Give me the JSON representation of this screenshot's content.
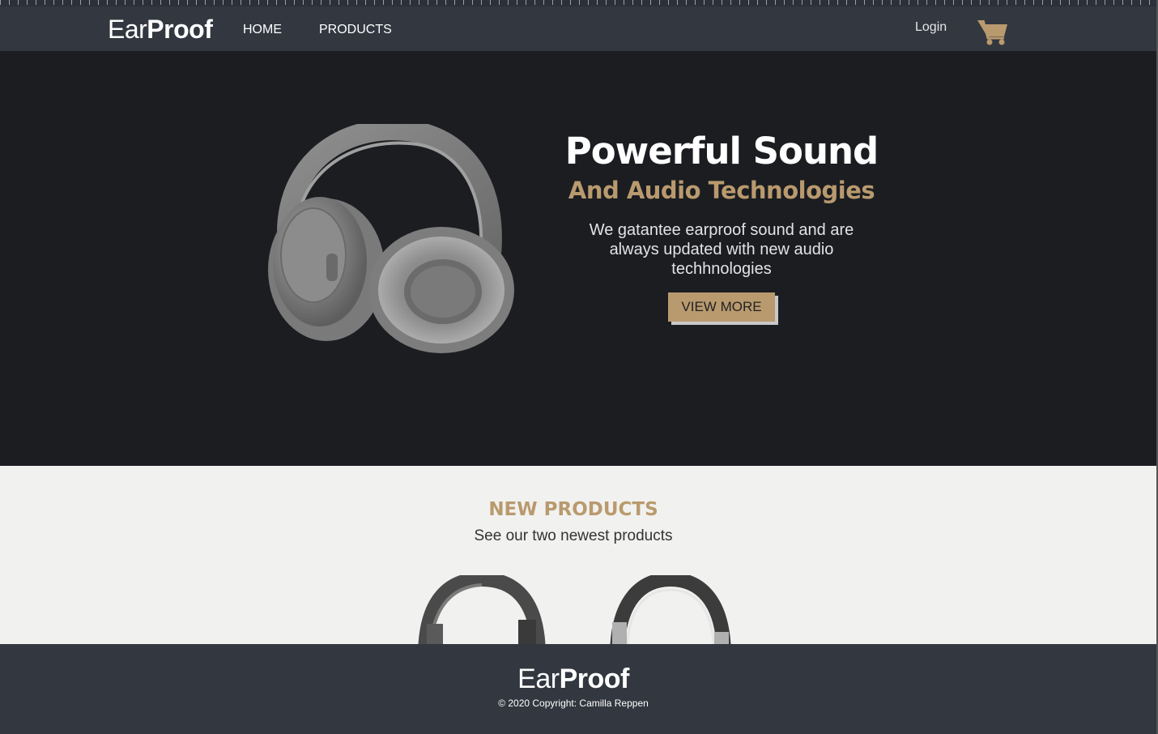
{
  "header": {
    "logo_light": "Ear",
    "logo_bold": "Proof",
    "nav": {
      "home": "HOME",
      "products": "PRODUCTS"
    },
    "login": "Login",
    "cart_icon": "shopping-cart-icon"
  },
  "hero": {
    "title": "Powerful Sound",
    "subtitle": "And Audio Technologies",
    "description": "We gatantee earproof sound and are always updated with new audio techhnologies",
    "button": "VIEW MORE",
    "image": "headphones-image"
  },
  "new_products": {
    "title": "NEW PRODUCTS",
    "subtitle": "See our two newest products",
    "items": [
      {
        "image": "headphones-product-image"
      },
      {
        "image": "headphones-product-image"
      }
    ]
  },
  "footer": {
    "logo_light": "Ear",
    "logo_bold": "Proof",
    "copyright": "© 2020 Copyright: Camilla Reppen"
  },
  "colors": {
    "accent": "#b99a6e",
    "nav_bg": "#323740",
    "hero_bg": "#1b1d21",
    "section_bg": "#f1f1ef"
  }
}
